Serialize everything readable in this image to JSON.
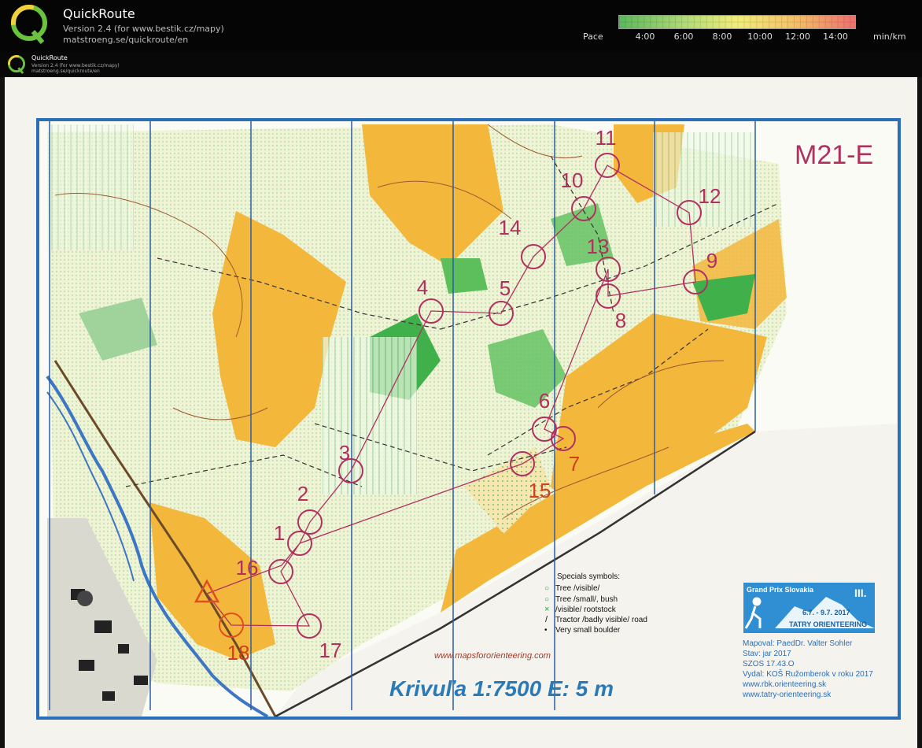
{
  "app": {
    "title": "QuickRoute",
    "version": "Version 2.4  (for www.bestik.cz/mapy)",
    "url": "matstroeng.se/quickroute/en"
  },
  "pace_legend": {
    "label": "Pace",
    "ticks": [
      "4:00",
      "6:00",
      "8:00",
      "10:00",
      "12:00",
      "14:00"
    ],
    "unit": "min/km",
    "colors": [
      "#66c266",
      "#bde07a",
      "#f2ee7a",
      "#f5c064",
      "#f07a7a"
    ]
  },
  "embedded_header": {
    "title": "QuickRoute",
    "version": "Version 2.4  (for www.bestik.cz/mapy)",
    "url": "matstroeng.se/quickroute/en"
  },
  "map": {
    "class_label": "M21-E",
    "scale_text": "Krivuľa 1:7500  E: 5 m",
    "website": "www.mapsfororienteering.com",
    "controls": [
      {
        "label": "1"
      },
      {
        "label": "2"
      },
      {
        "label": "3"
      },
      {
        "label": "4"
      },
      {
        "label": "5"
      },
      {
        "label": "6"
      },
      {
        "label": "7"
      },
      {
        "label": "8"
      },
      {
        "label": "9"
      },
      {
        "label": "10"
      },
      {
        "label": "11"
      },
      {
        "label": "12"
      },
      {
        "label": "13"
      },
      {
        "label": "14"
      },
      {
        "label": "15"
      },
      {
        "label": "16"
      },
      {
        "label": "17"
      },
      {
        "label": "18"
      }
    ],
    "specials": {
      "title": "Specials symbols:",
      "items": [
        {
          "symbol": "○",
          "text": "Tree /visible/"
        },
        {
          "symbol": "○",
          "text": "Tree /small/, bush"
        },
        {
          "symbol": "×",
          "text": "/visible/ rootstock"
        },
        {
          "symbol": "/",
          "text": "Tractor /badly visible/ road"
        },
        {
          "symbol": "•",
          "text": "Very small boulder"
        }
      ]
    },
    "event": {
      "name": "Grand Prix Slovakia",
      "number": "III.",
      "dates": "6.7. - 9.7.  2017",
      "org": "TATRY ORIENTEERING"
    },
    "credits": [
      "Mapoval: PaedDr. Valter Sohler",
      "Stav: jar 2017",
      "SZOS 17.43.O",
      "Vydal: KOŠ Ružomberok v roku 2017",
      "www.rbk.orienteering.sk",
      "www.tatry-orienteering.sk"
    ]
  }
}
